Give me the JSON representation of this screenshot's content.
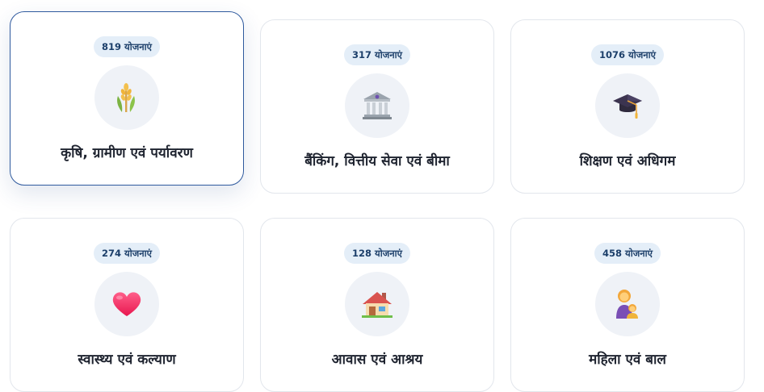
{
  "categories": [
    {
      "count": "819 योजनाएं",
      "title": "कृषि, ग्रामीण एवं पर्यावरण",
      "icon": "wheat-icon",
      "active": true
    },
    {
      "count": "317 योजनाएं",
      "title": "बैंकिंग, वित्तीय सेवा एवं बीमा",
      "icon": "bank-icon",
      "active": false
    },
    {
      "count": "1076 योजनाएं",
      "title": "शिक्षण एवं अधिगम",
      "icon": "graduation-cap-icon",
      "active": false
    },
    {
      "count": "274 योजनाएं",
      "title": "स्वास्थ्य एवं कल्याण",
      "icon": "heart-icon",
      "active": false
    },
    {
      "count": "128 योजनाएं",
      "title": "आवास एवं आश्रय",
      "icon": "house-icon",
      "active": false
    },
    {
      "count": "458 योजनाएं",
      "title": "महिला एवं बाल",
      "icon": "woman-and-child-icon",
      "active": false
    }
  ],
  "colors": {
    "badge_bg": "#e4eef8",
    "badge_text": "#1c3f6a",
    "active_border": "#2f5a9e",
    "icon_bg": "#eff2f7"
  }
}
